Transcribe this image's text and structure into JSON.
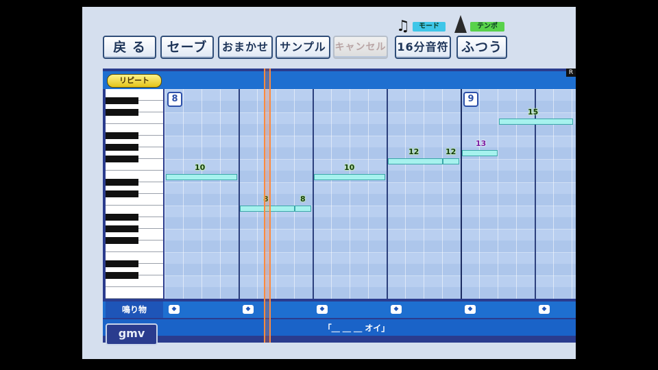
{
  "toolbar": {
    "buttons": [
      {
        "label": "戻 る",
        "enabled": true
      },
      {
        "label": "セーブ",
        "enabled": true
      },
      {
        "label": "おまかせ",
        "enabled": true
      },
      {
        "label": "サンプル",
        "enabled": true
      },
      {
        "label": "キャンセル",
        "enabled": false
      },
      {
        "label": "16分音符",
        "enabled": true
      },
      {
        "label": "ふつう",
        "enabled": true
      }
    ],
    "mode_tag": "モード",
    "tempo_tag": "テンポ"
  },
  "editor": {
    "repeat_label": "リピート",
    "measures": [
      "8",
      "9"
    ],
    "notes": [
      "10",
      "8",
      "8",
      "10",
      "12",
      "12",
      "13",
      "15"
    ],
    "sound_label": "鳴り物",
    "lyric": "「＿ ＿ ＿ オイ」",
    "logo": "gmv",
    "corner_mark": "R"
  },
  "colors": {
    "background": "#d5dfee",
    "note": "#a6f2ee",
    "track_blue": "#1e6fd0",
    "cursor": "#ff8a3c"
  }
}
